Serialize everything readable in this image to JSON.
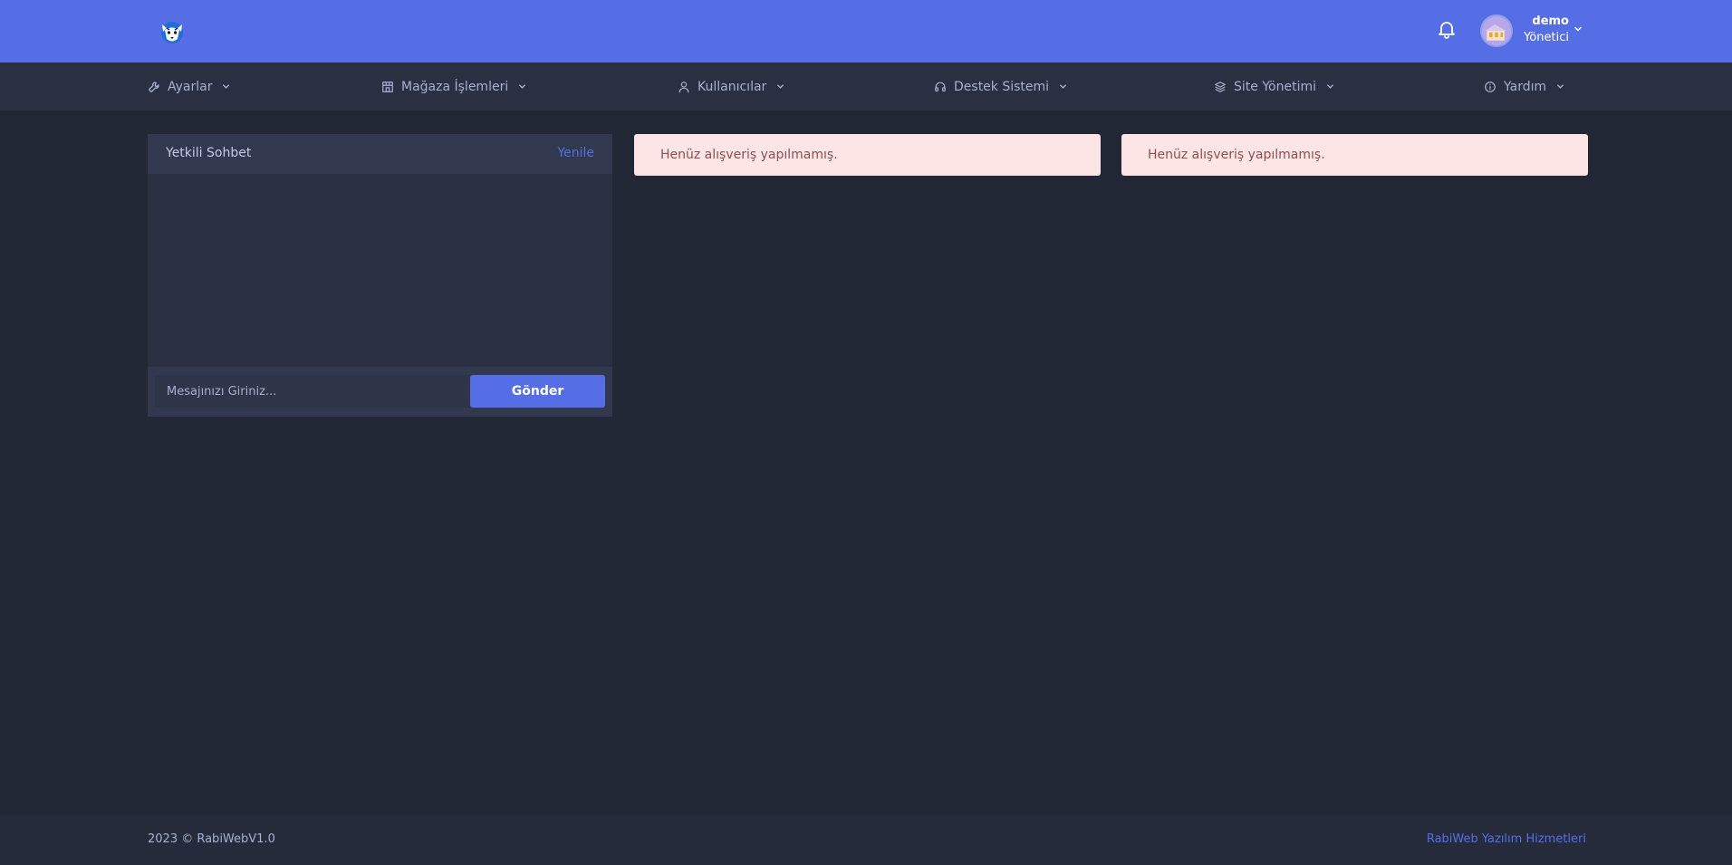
{
  "header": {
    "logo_icon": "tiger-logo-icon",
    "notifications_icon": "bell-icon",
    "user": {
      "name": "demo",
      "role": "Yönetici",
      "avatar_icon": "avatar-image"
    }
  },
  "nav": {
    "items": [
      {
        "label": "Ayarlar",
        "icon": "wrench-icon"
      },
      {
        "label": "Mağaza İşlemleri",
        "icon": "store-icon"
      },
      {
        "label": "Kullanıcılar",
        "icon": "user-icon"
      },
      {
        "label": "Destek Sistemi",
        "icon": "headset-icon"
      },
      {
        "label": "Site Yönetimi",
        "icon": "layers-icon"
      },
      {
        "label": "Yardım",
        "icon": "info-icon"
      }
    ]
  },
  "chat": {
    "title": "Yetkili Sohbet",
    "refresh_label": "Yenile",
    "input_placeholder": "Mesajınızı Giriniz...",
    "send_label": "Gönder"
  },
  "alerts": [
    {
      "text": "Henüz alışveriş yapılmamış."
    },
    {
      "text": "Henüz alışveriş yapılmamış."
    }
  ],
  "footer": {
    "copyright": "2023 © RabiWebV1.0",
    "company_link": "RabiWeb Yazılım Hizmetleri"
  },
  "colors": {
    "primary": "#556ee6",
    "body_bg": "#222736",
    "card_bg": "#2a3042",
    "alert_bg": "#fee5e5",
    "alert_text": "#8c4e53"
  }
}
